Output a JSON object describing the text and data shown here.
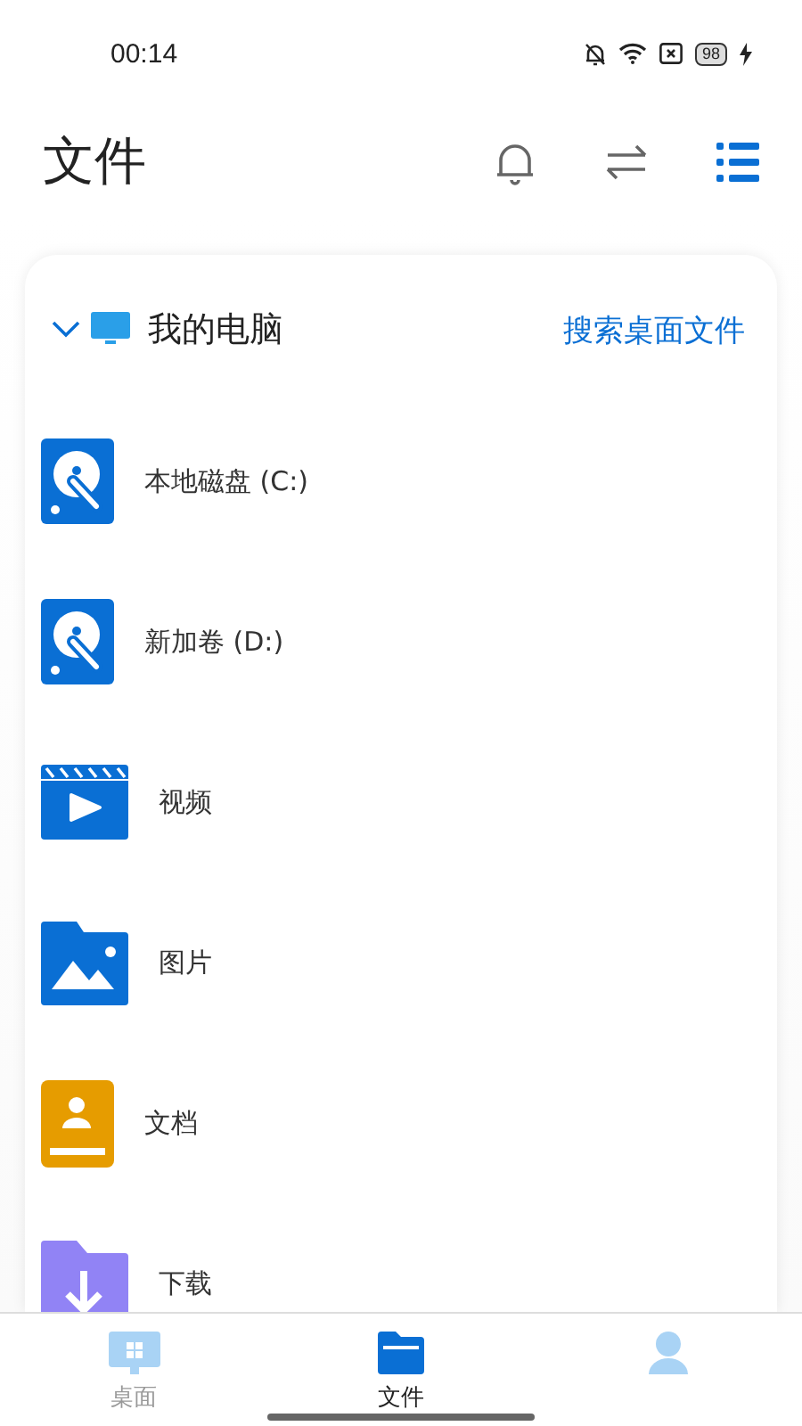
{
  "status_bar": {
    "time": "00:14",
    "battery": "98"
  },
  "header": {
    "title": "文件"
  },
  "card": {
    "title": "我的电脑",
    "expanded": true,
    "link": "搜索桌面文件",
    "items": [
      {
        "label": "本地磁盘 (C:)",
        "kind": "disk"
      },
      {
        "label": "新加卷 (D:)",
        "kind": "disk"
      },
      {
        "label": "视频",
        "kind": "video"
      },
      {
        "label": "图片",
        "kind": "image"
      },
      {
        "label": "文档",
        "kind": "document"
      },
      {
        "label": "下载",
        "kind": "download"
      }
    ]
  },
  "tabs": [
    {
      "label": "桌面",
      "kind": "desktop",
      "selected": false
    },
    {
      "label": "文件",
      "kind": "folder",
      "selected": true
    },
    {
      "kind": "person",
      "selected": false
    }
  ]
}
